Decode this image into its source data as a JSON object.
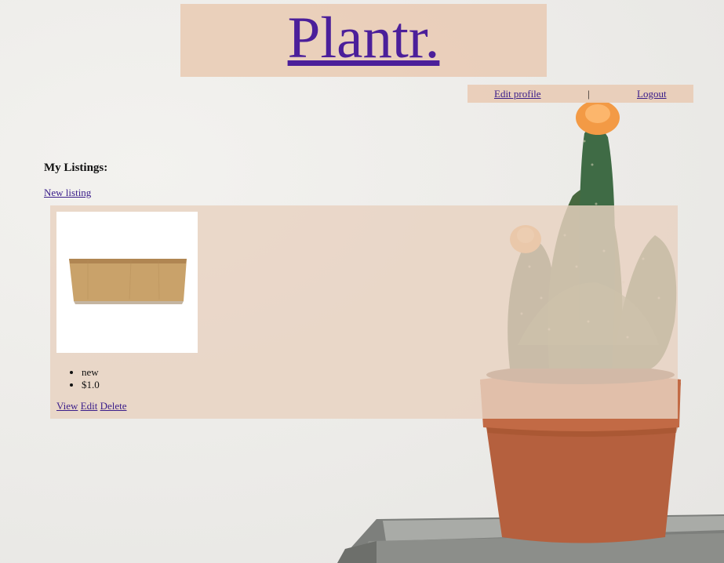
{
  "header": {
    "logo": "Plantr."
  },
  "nav": {
    "edit_profile": "Edit profile",
    "separator": "|",
    "logout": "Logout"
  },
  "main": {
    "title": "My Listings:",
    "new_listing": "New listing",
    "listings": [
      {
        "details": [
          "new",
          "$1.0"
        ],
        "actions": {
          "view": "View",
          "edit": "Edit",
          "delete": "Delete"
        }
      }
    ]
  },
  "colors": {
    "header_bg": "#e9ceb8",
    "card_bg": "#e8d2c1",
    "link": "#3a1d8a",
    "logo": "#4b1f9a"
  }
}
